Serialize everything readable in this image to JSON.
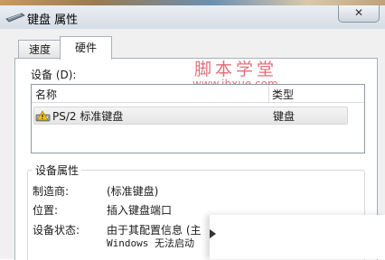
{
  "window": {
    "title": "键盘 属性",
    "close_label": "✕"
  },
  "tabs": [
    {
      "label": "速度",
      "active": false
    },
    {
      "label": "硬件",
      "active": true
    }
  ],
  "devices": {
    "label": "设备 (D):",
    "columns": [
      "名称",
      "类型"
    ],
    "rows": [
      {
        "name": "PS/2 标准键盘",
        "type": "键盘"
      }
    ]
  },
  "watermark": {
    "text": "脚本学堂",
    "url": "www.jbxue.com"
  },
  "properties": {
    "group_title": "设备属性",
    "manufacturer_label": "制造商:",
    "manufacturer_value": "(标准键盘)",
    "location_label": "位置:",
    "location_value": "插入键盘端口",
    "status_label": "设备状态:",
    "status_value_line1": "由于其配置信息 (主",
    "status_value_line2": "Windows 无法启动"
  },
  "icons": {
    "window": "keyboard-icon",
    "device": "keyboard-warning-icon"
  }
}
